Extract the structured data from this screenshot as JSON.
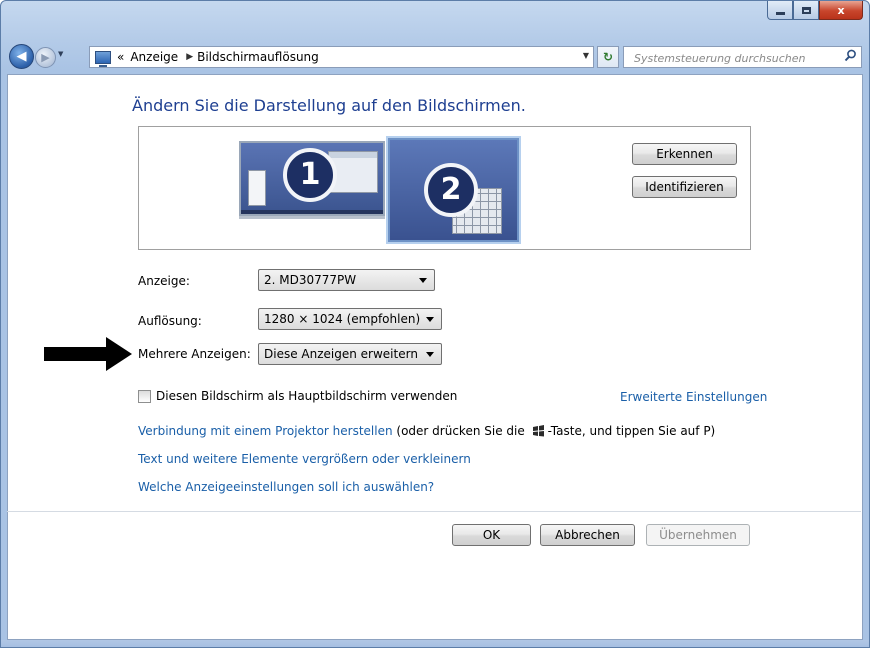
{
  "window": {
    "caption_buttons": [
      "minimize-icon",
      "maximize-icon",
      "close-icon"
    ],
    "close_glyph": "x"
  },
  "navbar": {
    "back_glyph": "◀",
    "forward_glyph": "▶",
    "breadcrumb_prefix": "«",
    "breadcrumb": [
      "Anzeige",
      "Bildschirmauflösung"
    ],
    "breadcrumb_separator": "▶",
    "search_placeholder": "Systemsteuerung durchsuchen"
  },
  "main": {
    "heading": "Ändern Sie die Darstellung auf den Bildschirmen.",
    "monitors": [
      {
        "number": "1",
        "selected": false
      },
      {
        "number": "2",
        "selected": true
      }
    ],
    "detect_label": "Erkennen",
    "identify_label": "Identifizieren",
    "display_label": "Anzeige:",
    "display_value": "2. MD30777PW",
    "resolution_label": "Auflösung:",
    "resolution_value": "1280 × 1024 (empfohlen)",
    "multi_label": "Mehrere Anzeigen:",
    "multi_value": "Diese Anzeigen erweitern",
    "primary_checkbox_label": "Diesen Bildschirm als Hauptbildschirm verwenden",
    "primary_checked": false,
    "advanced_link": "Erweiterte Einstellungen",
    "projector_link": "Verbindung mit einem Projektor herstellen",
    "projector_hint_before": " (oder drücken Sie die",
    "projector_hint_after": "-Taste, und tippen Sie auf P)",
    "text_size_link": "Text und weitere Elemente vergrößern oder verkleinern",
    "which_settings_link": "Welche Anzeigeeinstellungen soll ich auswählen?"
  },
  "footer": {
    "ok_label": "OK",
    "cancel_label": "Abbrechen",
    "apply_label": "Übernehmen",
    "apply_enabled": false
  },
  "colors": {
    "heading": "#1e3f91",
    "link": "#1a5fa8",
    "monitor_fill": "#3b548f",
    "badge": "#1d2f63"
  }
}
